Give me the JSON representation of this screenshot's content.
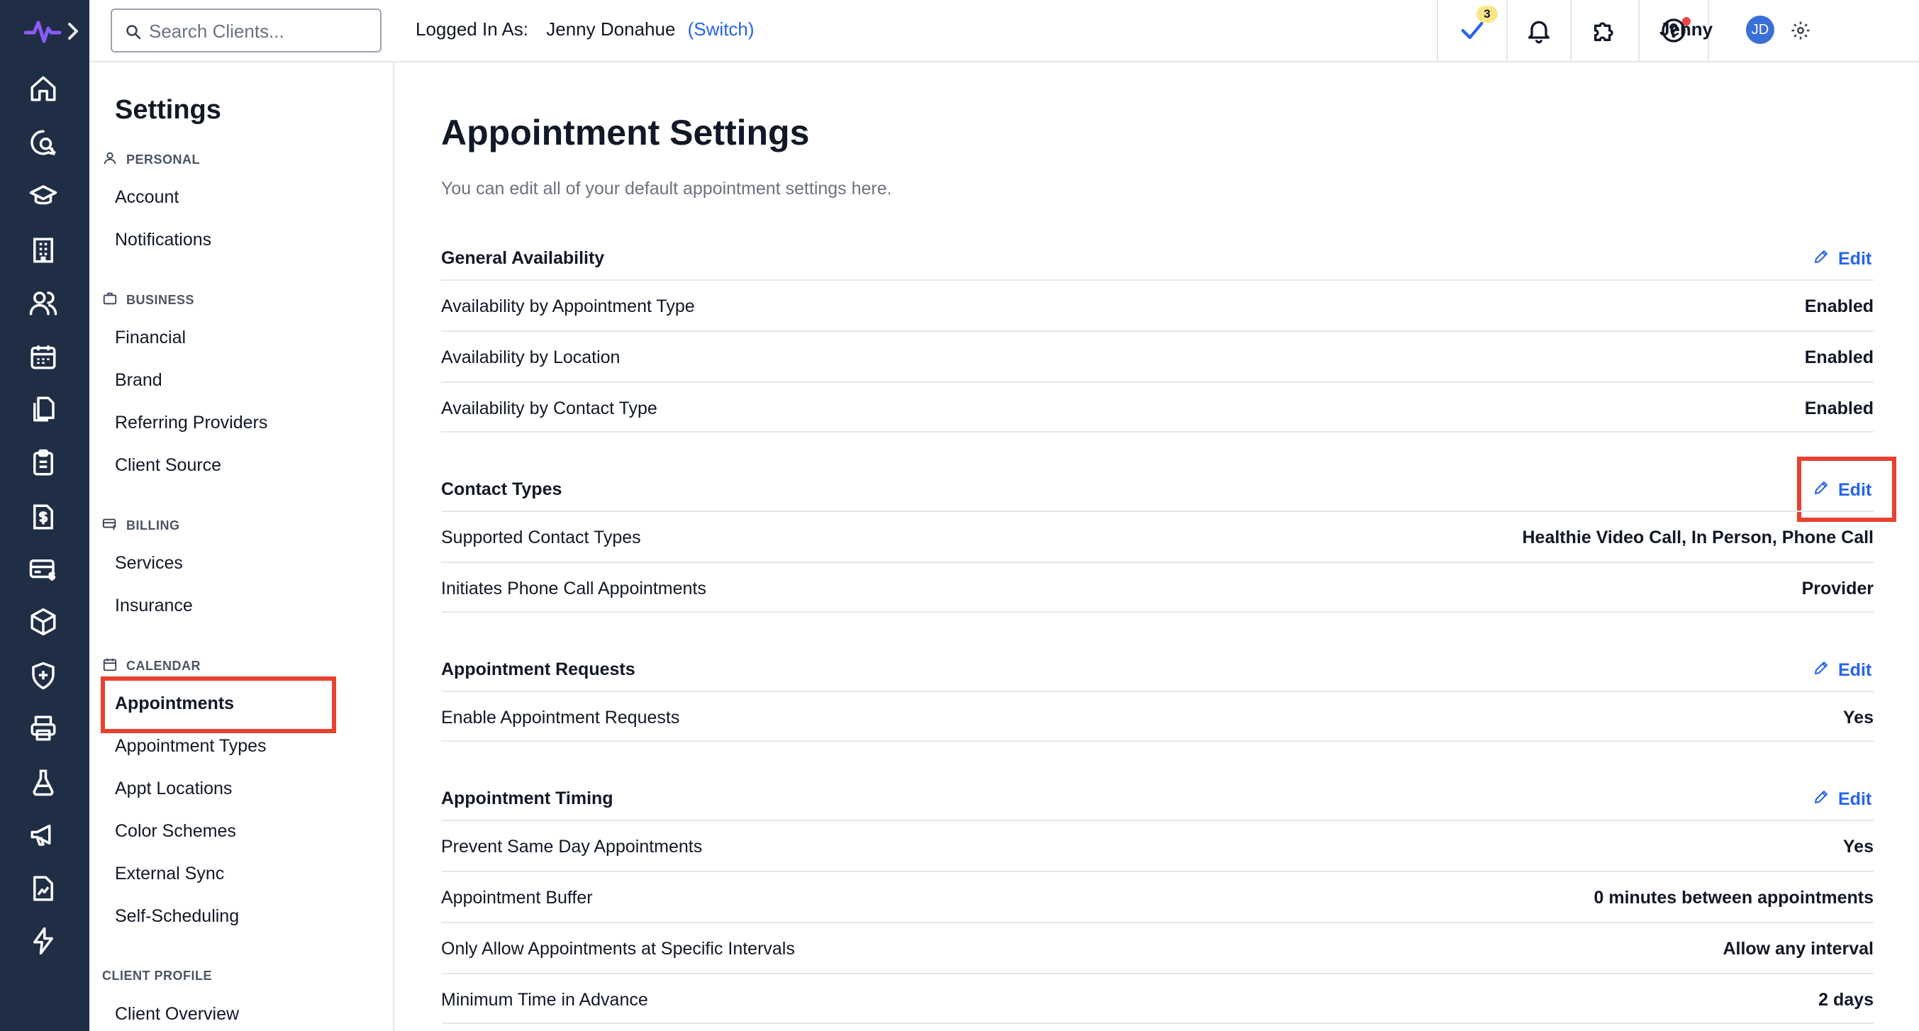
{
  "header": {
    "search_placeholder": "Search Clients...",
    "logged_in_label": "Logged In As:",
    "logged_in_user": "Jenny Donahue",
    "switch_label": "(Switch)",
    "tasks_badge": "3",
    "user_name": "Jenny",
    "avatar_initials": "JD"
  },
  "sidebar": {
    "title": "Settings",
    "sections": {
      "personal": {
        "label": "PERSONAL",
        "items": [
          "Account",
          "Notifications"
        ]
      },
      "business": {
        "label": "BUSINESS",
        "items": [
          "Financial",
          "Brand",
          "Referring Providers",
          "Client Source"
        ]
      },
      "billing": {
        "label": "BILLING",
        "items": [
          "Services",
          "Insurance"
        ]
      },
      "calendar": {
        "label": "CALENDAR",
        "items": [
          "Appointments",
          "Appointment Types",
          "Appt Locations",
          "Color Schemes",
          "External Sync",
          "Self-Scheduling"
        ]
      },
      "client_profile": {
        "label": "CLIENT PROFILE",
        "items": [
          "Client Overview"
        ]
      }
    },
    "active_item": "Appointments"
  },
  "main": {
    "title": "Appointment Settings",
    "subtitle": "You can edit all of your default appointment settings here.",
    "edit_label": "Edit",
    "groups": [
      {
        "title": "General Availability",
        "rows": [
          {
            "label": "Availability by Appointment Type",
            "value": "Enabled"
          },
          {
            "label": "Availability by Location",
            "value": "Enabled"
          },
          {
            "label": "Availability by Contact Type",
            "value": "Enabled"
          }
        ]
      },
      {
        "title": "Contact Types",
        "rows": [
          {
            "label": "Supported Contact Types",
            "value": "Healthie Video Call, In Person, Phone Call"
          },
          {
            "label": "Initiates Phone Call Appointments",
            "value": "Provider"
          }
        ]
      },
      {
        "title": "Appointment Requests",
        "rows": [
          {
            "label": "Enable Appointment Requests",
            "value": "Yes"
          }
        ]
      },
      {
        "title": "Appointment Timing",
        "rows": [
          {
            "label": "Prevent Same Day Appointments",
            "value": "Yes"
          },
          {
            "label": "Appointment Buffer",
            "value": "0 minutes between appointments"
          },
          {
            "label": "Only Allow Appointments at Specific Intervals",
            "value": "Allow any interval"
          },
          {
            "label": "Minimum Time in Advance",
            "value": "2 days"
          }
        ]
      }
    ]
  },
  "colors": {
    "rail_bg": "#1f2d45",
    "accent_blue": "#2563eb",
    "highlight_red": "#e8412f",
    "badge_yellow": "#fde68a"
  },
  "icons": {
    "rail": [
      "logo-icon",
      "home-icon",
      "chat-search-icon",
      "graduation-cap-icon",
      "building-icon",
      "users-icon",
      "calendar-icon",
      "documents-icon",
      "clipboard-icon",
      "invoice-icon",
      "payment-card-icon",
      "package-icon",
      "shield-plus-icon",
      "printer-icon",
      "flask-icon",
      "megaphone-icon",
      "chart-doc-icon",
      "lightning-icon"
    ]
  }
}
